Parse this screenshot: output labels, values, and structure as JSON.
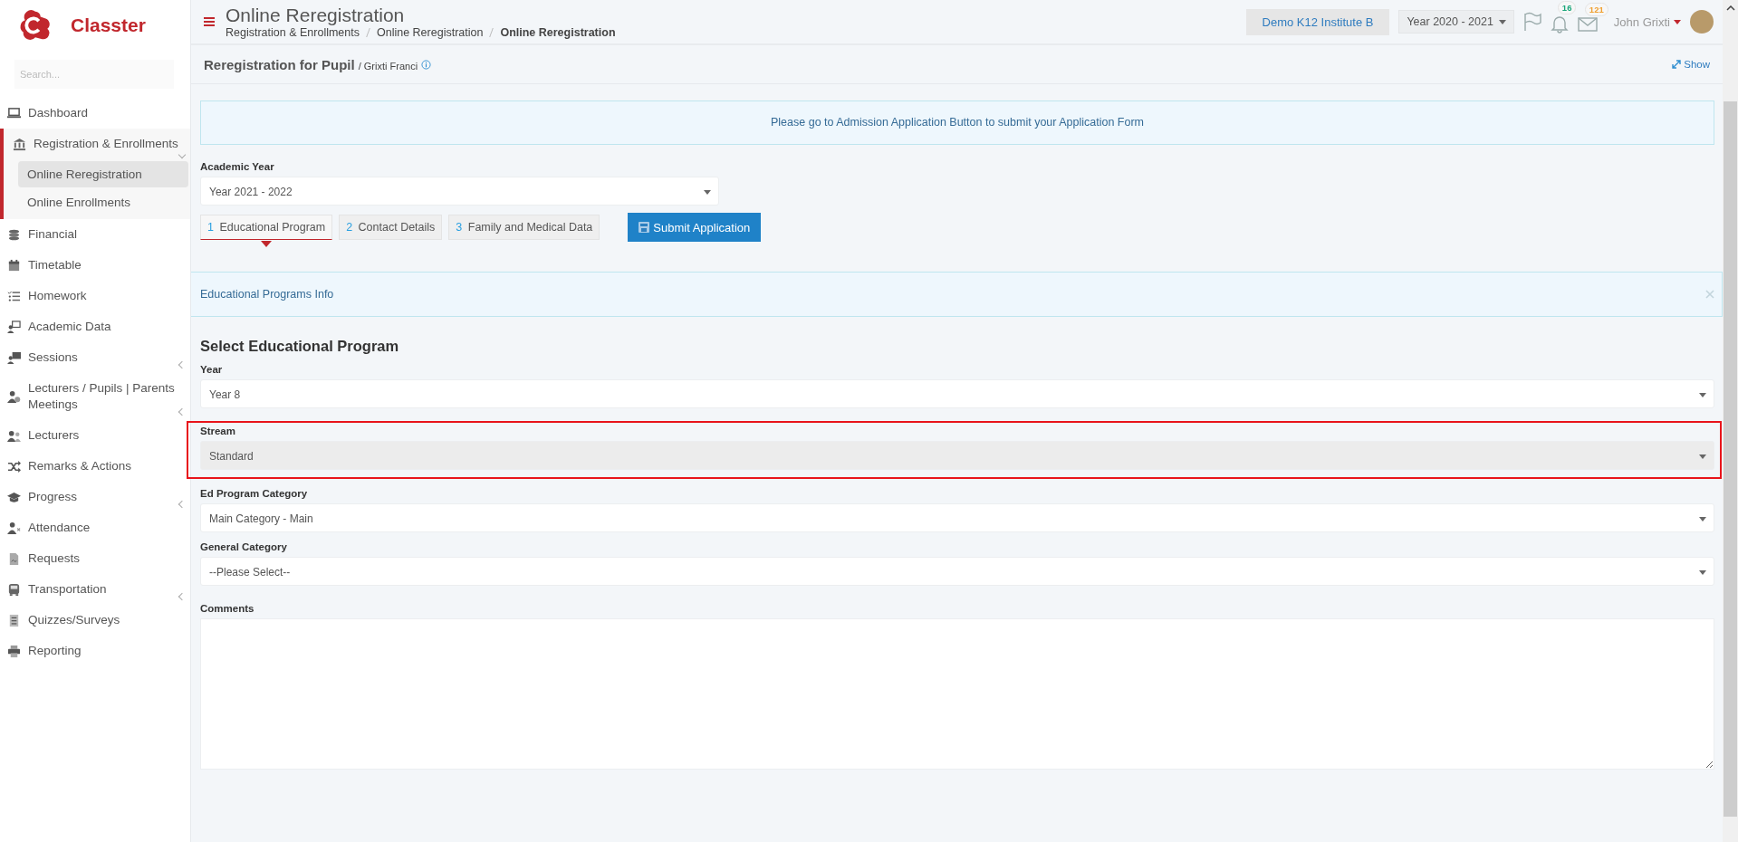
{
  "brand": {
    "name": "Classter"
  },
  "sidebar": {
    "search": {
      "placeholder": "Search..."
    },
    "items": [
      {
        "label": "Dashboard",
        "expandable": false,
        "expanded": false
      },
      {
        "label": "Registration & Enrollments",
        "expandable": true,
        "expanded": true,
        "children": [
          {
            "label": "Online Reregistration",
            "selected": true
          },
          {
            "label": "Online Enrollments",
            "selected": false
          }
        ]
      },
      {
        "label": "Financial",
        "expandable": false,
        "expanded": false
      },
      {
        "label": "Timetable",
        "expandable": false,
        "expanded": false
      },
      {
        "label": "Homework",
        "expandable": false,
        "expanded": false
      },
      {
        "label": "Academic Data",
        "expandable": false,
        "expanded": false
      },
      {
        "label": "Sessions",
        "expandable": true,
        "expanded": false
      },
      {
        "label": "Lecturers / Pupils | Parents Meetings",
        "expandable": true,
        "expanded": false
      },
      {
        "label": "Lecturers",
        "expandable": false,
        "expanded": false
      },
      {
        "label": "Remarks & Actions",
        "expandable": false,
        "expanded": false
      },
      {
        "label": "Progress",
        "expandable": true,
        "expanded": false
      },
      {
        "label": "Attendance",
        "expandable": false,
        "expanded": false
      },
      {
        "label": "Requests",
        "expandable": false,
        "expanded": false
      },
      {
        "label": "Transportation",
        "expandable": true,
        "expanded": false
      },
      {
        "label": "Quizzes/Surveys",
        "expandable": false,
        "expanded": false
      },
      {
        "label": "Reporting",
        "expandable": false,
        "expanded": false
      }
    ]
  },
  "header": {
    "title": "Online Reregistration",
    "breadcrumb": [
      {
        "label": "Registration & Enrollments",
        "current": false
      },
      {
        "label": "Online Reregistration",
        "current": false
      },
      {
        "label": "Online Reregistration",
        "current": true
      }
    ],
    "institute": "Demo K12 Institute B",
    "year": "Year 2020 - 2021",
    "badges": [
      {
        "kind": "bell",
        "count": "16",
        "color": "#1aa67a"
      },
      {
        "kind": "mail",
        "count": "121",
        "color": "#f0a030"
      }
    ],
    "user": "John Grixti"
  },
  "panel": {
    "title": "Reregistration for Pupil",
    "subtitle": "/ Grixti Franci",
    "show": "Show",
    "notice": "Please go to Admission Application Button to submit your Application Form",
    "academic_year": {
      "label": "Academic Year",
      "value": "Year 2021 - 2022"
    },
    "steps": [
      {
        "number": "1",
        "label": "Educational Program",
        "selected": true
      },
      {
        "number": "2",
        "label": "Contact Details",
        "selected": false
      },
      {
        "number": "3",
        "label": "Family and Medical Data",
        "selected": false
      }
    ],
    "submit": "Submit Application",
    "info": "Educational Programs Info",
    "section_title": "Select Educational Program",
    "fields": [
      {
        "label": "Year",
        "value": "Year 8",
        "disabled": false,
        "highlighted": false
      },
      {
        "label": "Stream",
        "value": "Standard",
        "disabled": true,
        "highlighted": true
      },
      {
        "label": "Ed Program Category",
        "value": "Main Category - Main",
        "disabled": false,
        "highlighted": false
      },
      {
        "label": "General Category",
        "value": "--Please Select--",
        "disabled": false,
        "highlighted": false
      }
    ],
    "comments": {
      "label": "Comments"
    }
  }
}
